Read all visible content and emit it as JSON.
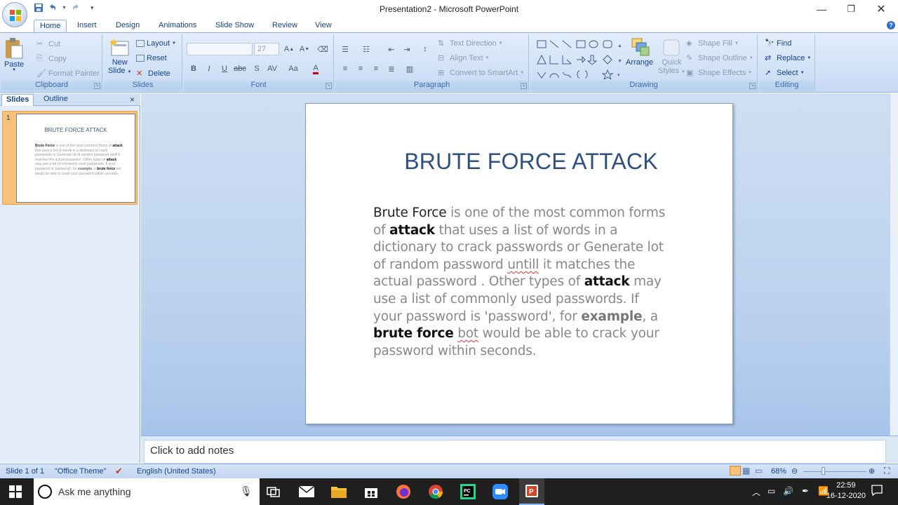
{
  "window": {
    "title": "Presentation2 - Microsoft PowerPoint"
  },
  "tabs": [
    "Home",
    "Insert",
    "Design",
    "Animations",
    "Slide Show",
    "Review",
    "View"
  ],
  "ribbon": {
    "clipboard": {
      "label": "Clipboard",
      "paste": "Paste",
      "cut": "Cut",
      "copy": "Copy",
      "format_painter": "Format Painter"
    },
    "slides": {
      "label": "Slides",
      "new_slide_1": "New",
      "new_slide_2": "Slide",
      "layout": "Layout",
      "reset": "Reset",
      "delete": "Delete"
    },
    "font": {
      "label": "Font",
      "font_name": "",
      "font_size": "27"
    },
    "paragraph": {
      "label": "Paragraph",
      "text_direction": "Text Direction",
      "align_text": "Align Text",
      "convert_smartart": "Convert to SmartArt"
    },
    "drawing": {
      "label": "Drawing",
      "arrange": "Arrange",
      "quick_styles_1": "Quick",
      "quick_styles_2": "Styles",
      "shape_fill": "Shape Fill",
      "shape_outline": "Shape Outline",
      "shape_effects": "Shape Effects"
    },
    "editing": {
      "label": "Editing",
      "find": "Find",
      "replace": "Replace",
      "select": "Select"
    }
  },
  "left_panel": {
    "tab_slides": "Slides",
    "tab_outline": "Outline",
    "close": "×",
    "thumbnail": {
      "number": "1",
      "title": "BRUTE FORCE ATTACK"
    }
  },
  "slide": {
    "title": "BRUTE FORCE ATTACK",
    "body": {
      "t1": "Brute Force",
      "t2": " is one of the most common forms of ",
      "t3": "attack",
      "t4": " that uses a list of words in a dictionary to crack passwords or Generate lot of random password ",
      "t5": "untill",
      "t6": " it matches the actual password . Other types of ",
      "t7": "attack",
      "t8": " may use a list of commonly used passwords. If your password is 'password', for ",
      "t9": "example",
      "t10": ", a ",
      "t11": "brute force",
      "t12": " ",
      "t13": "bot",
      "t14": " would be able to crack your password within seconds."
    }
  },
  "notes": {
    "placeholder": "Click to add notes"
  },
  "statusbar": {
    "slide_info": "Slide 1 of 1",
    "theme": "\"Office Theme\"",
    "language": "English (United States)",
    "zoom": "68%"
  },
  "taskbar": {
    "search_placeholder": "Ask me anything",
    "time": "22:59",
    "date": "16-12-2020"
  }
}
